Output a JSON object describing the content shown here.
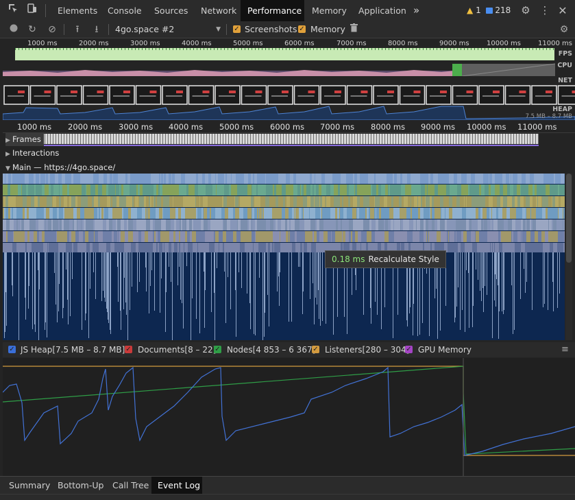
{
  "tabs": {
    "items": [
      "Elements",
      "Console",
      "Sources",
      "Network",
      "Performance",
      "Memory",
      "Application"
    ],
    "more": "»",
    "warn_count": "1",
    "msg_count": "218"
  },
  "toolbar": {
    "profile_select": "4go.space #2",
    "screenshots_label": "Screenshots",
    "memory_label": "Memory"
  },
  "overview": {
    "ticks": [
      "1000 ms",
      "2000 ms",
      "3000 ms",
      "4000 ms",
      "5000 ms",
      "6000 ms",
      "7000 ms",
      "8000 ms",
      "9000 ms",
      "10000 ms",
      "11000 ms"
    ],
    "fps_label": "FPS",
    "cpu_label": "CPU",
    "net_label": "NET",
    "heap_label": "HEAP",
    "heap_range": "7.5 MB – 8.7 MB"
  },
  "timeline": {
    "ticks": [
      "1000 ms",
      "2000 ms",
      "3000 ms",
      "4000 ms",
      "5000 ms",
      "6000 ms",
      "7000 ms",
      "8000 ms",
      "9000 ms",
      "10000 ms",
      "11000 ms"
    ],
    "frames_label": "Frames",
    "interactions_label": "Interactions",
    "main_label": "Main — https://4go.space/"
  },
  "tooltip": {
    "duration": "0.18 ms",
    "name": "Recalculate Style"
  },
  "counters": {
    "js_heap": "JS Heap[7.5 MB – 8.7 MB]",
    "documents": "Documents[8 – 22]",
    "nodes": "Nodes[4 853 – 6 367]",
    "listeners": "Listeners[280 – 304]",
    "gpu": "GPU Memory",
    "colors": {
      "js_heap": "#3a6fd8",
      "documents": "#c93a3a",
      "nodes": "#2f9e47",
      "listeners": "#d39b3f",
      "gpu": "#a444c4"
    }
  },
  "bottom_tabs": [
    "Summary",
    "Bottom-Up",
    "Call Tree",
    "Event Log"
  ]
}
